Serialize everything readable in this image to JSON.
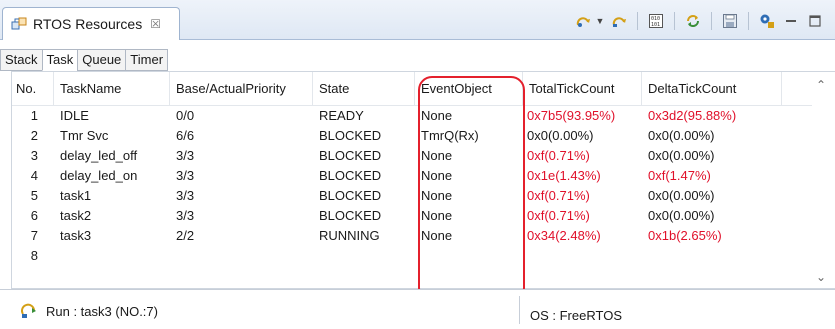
{
  "view": {
    "title": "RTOS Resources",
    "close_glyph": "☒",
    "icon": "rtos-resources-icon"
  },
  "toolbar": {
    "icons": [
      "refresh-task-icon",
      "dropdown-arrow-icon",
      "refresh-icon",
      "binary-view-icon",
      "sync-icon",
      "save-icon",
      "settings-icon",
      "minimize-icon",
      "maximize-icon"
    ]
  },
  "sub_tabs": [
    {
      "label": "Stack",
      "active": false
    },
    {
      "label": "Task",
      "active": true
    },
    {
      "label": "Queue",
      "active": false
    },
    {
      "label": "Timer",
      "active": false
    }
  ],
  "table": {
    "columns": [
      "No.",
      "TaskName",
      "Base/ActualPriority",
      "State",
      "EventObject",
      "TotalTickCount",
      "DeltaTickCount"
    ],
    "rows": [
      {
        "no": "1",
        "name": "IDLE",
        "priority": "0/0",
        "state": "READY",
        "event": "None",
        "total": "0x7b5(93.95%)",
        "total_red": true,
        "delta": "0x3d2(95.88%)",
        "delta_red": true
      },
      {
        "no": "2",
        "name": "Tmr Svc",
        "priority": "6/6",
        "state": "BLOCKED",
        "event": "TmrQ(Rx)",
        "total": "0x0(0.00%)",
        "total_red": false,
        "delta": "0x0(0.00%)",
        "delta_red": false
      },
      {
        "no": "3",
        "name": "delay_led_off",
        "priority": "3/3",
        "state": "BLOCKED",
        "event": "None",
        "total": "0xf(0.71%)",
        "total_red": true,
        "delta": "0x0(0.00%)",
        "delta_red": false
      },
      {
        "no": "4",
        "name": "delay_led_on",
        "priority": "3/3",
        "state": "BLOCKED",
        "event": "None",
        "total": "0x1e(1.43%)",
        "total_red": true,
        "delta": "0xf(1.47%)",
        "delta_red": true
      },
      {
        "no": "5",
        "name": "task1",
        "priority": "3/3",
        "state": "BLOCKED",
        "event": "None",
        "total": "0xf(0.71%)",
        "total_red": true,
        "delta": "0x0(0.00%)",
        "delta_red": false
      },
      {
        "no": "6",
        "name": "task2",
        "priority": "3/3",
        "state": "BLOCKED",
        "event": "None",
        "total": "0xf(0.71%)",
        "total_red": true,
        "delta": "0x0(0.00%)",
        "delta_red": false
      },
      {
        "no": "7",
        "name": "task3",
        "priority": "2/2",
        "state": "RUNNING",
        "event": "None",
        "total": "0x34(2.48%)",
        "total_red": true,
        "delta": "0x1b(2.65%)",
        "delta_red": true
      },
      {
        "no": "8",
        "name": "",
        "priority": "",
        "state": "",
        "event": "",
        "total": "",
        "total_red": false,
        "delta": "",
        "delta_red": false
      }
    ]
  },
  "status": {
    "run_text": "Run : task3 (NO.:7)",
    "os_text": "OS : FreeRTOS"
  },
  "colors": {
    "highlight": "#e4202c",
    "red_value": "#e0102a"
  }
}
